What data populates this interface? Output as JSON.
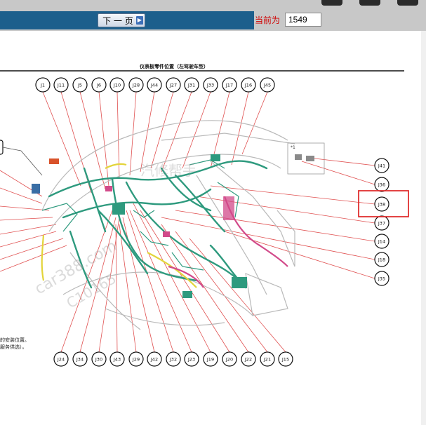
{
  "toolbar": {
    "next_page_label": "下 一 页",
    "current_label": "当前为",
    "current_page": "1549"
  },
  "diagram": {
    "title": "仪表板零件位置（左驾驶车型）",
    "top_connectors": [
      "J1",
      "J11",
      "J5",
      "J6",
      "J10",
      "J28",
      "J44",
      "J27",
      "J31",
      "J33",
      "J17",
      "J16",
      "J45"
    ],
    "right_connectors": [
      "J41",
      "J36",
      "J38",
      "J37",
      "J14",
      "J18",
      "J35"
    ],
    "bottom_connectors": [
      "J24",
      "J34",
      "J30",
      "J43",
      "J29",
      "J42",
      "J32",
      "J23",
      "J19",
      "J20",
      "J22",
      "J21",
      "J15"
    ],
    "inset_label": "*1",
    "notes": [
      "的安装位置。",
      "服务供选）。"
    ],
    "highlighted_connector": "J38",
    "watermarks": [
      "car388.com",
      "C10165",
      "汽修帮手"
    ],
    "colors": {
      "harness": "#2e9a7e",
      "yellow_harness": "#e3d43a",
      "pink_harness": "#d24a8a",
      "leader_line": "#e05050",
      "highlight_box": "#e03030",
      "toolbar_blue": "#1d5f8c"
    }
  }
}
